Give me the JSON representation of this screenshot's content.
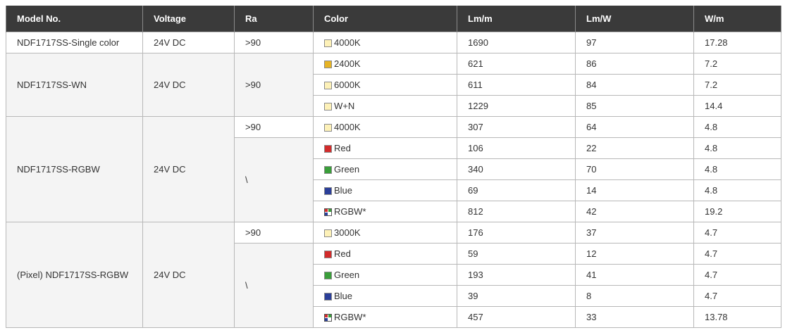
{
  "colors": {
    "header_bg": "#3a3a3a",
    "header_text": "#ffffff",
    "merged_cell_bg": "#f4f4f4",
    "swatch_4000k": "#fdf1b8",
    "swatch_2400k": "#e6b324",
    "swatch_6000k": "#fdf1b8",
    "swatch_wn": "#fdf1b8",
    "swatch_3000k": "#fdf1b8",
    "swatch_red": "#d22b2b",
    "swatch_green": "#3a9e3a",
    "swatch_blue": "#2b3f99"
  },
  "table": {
    "headers": [
      "Model No.",
      "Voltage",
      "Ra",
      "Color",
      "Lm/m",
      "Lm/W",
      "W/m"
    ],
    "groups": [
      {
        "model": "NDF1717SS-Single color",
        "voltage": "24V DC",
        "rows": [
          {
            "ra": ">90",
            "color": "4000K",
            "swatch": "4000k",
            "lm_m": "1690",
            "lm_w": "97",
            "w_m": "17.28"
          }
        ]
      },
      {
        "model": "NDF1717SS-WN",
        "voltage": "24V DC",
        "ra": ">90",
        "rows": [
          {
            "color": "2400K",
            "swatch": "2400k",
            "lm_m": "621",
            "lm_w": "86",
            "w_m": "7.2"
          },
          {
            "color": "6000K",
            "swatch": "6000k",
            "lm_m": "611",
            "lm_w": "84",
            "w_m": "7.2"
          },
          {
            "color": "W+N",
            "swatch": "wn",
            "lm_m": "1229",
            "lm_w": "85",
            "w_m": "14.4"
          }
        ]
      },
      {
        "model": "NDF1717SS-RGBW",
        "voltage": "24V DC",
        "ra_first": ">90",
        "ra_rest": "\\",
        "rows": [
          {
            "color": "4000K",
            "swatch": "4000k",
            "lm_m": "307",
            "lm_w": "64",
            "w_m": "4.8"
          },
          {
            "color": "Red",
            "swatch": "red",
            "lm_m": "106",
            "lm_w": "22",
            "w_m": "4.8"
          },
          {
            "color": "Green",
            "swatch": "green",
            "lm_m": "340",
            "lm_w": "70",
            "w_m": "4.8"
          },
          {
            "color": "Blue",
            "swatch": "blue",
            "lm_m": "69",
            "lm_w": "14",
            "w_m": "4.8"
          },
          {
            "color": "RGBW*",
            "swatch": "rgbw",
            "lm_m": "812",
            "lm_w": "42",
            "w_m": "19.2"
          }
        ]
      },
      {
        "model": "(Pixel) NDF1717SS-RGBW",
        "voltage": "24V DC",
        "ra_first": ">90",
        "ra_rest": "\\",
        "rows": [
          {
            "color": "3000K",
            "swatch": "3000k",
            "lm_m": "176",
            "lm_w": "37",
            "w_m": "4.7"
          },
          {
            "color": "Red",
            "swatch": "red",
            "lm_m": "59",
            "lm_w": "12",
            "w_m": "4.7"
          },
          {
            "color": "Green",
            "swatch": "green",
            "lm_m": "193",
            "lm_w": "41",
            "w_m": "4.7"
          },
          {
            "color": "Blue",
            "swatch": "blue",
            "lm_m": "39",
            "lm_w": "8",
            "w_m": "4.7"
          },
          {
            "color": "RGBW*",
            "swatch": "rgbw",
            "lm_m": "457",
            "lm_w": "33",
            "w_m": "13.78"
          }
        ]
      }
    ]
  }
}
